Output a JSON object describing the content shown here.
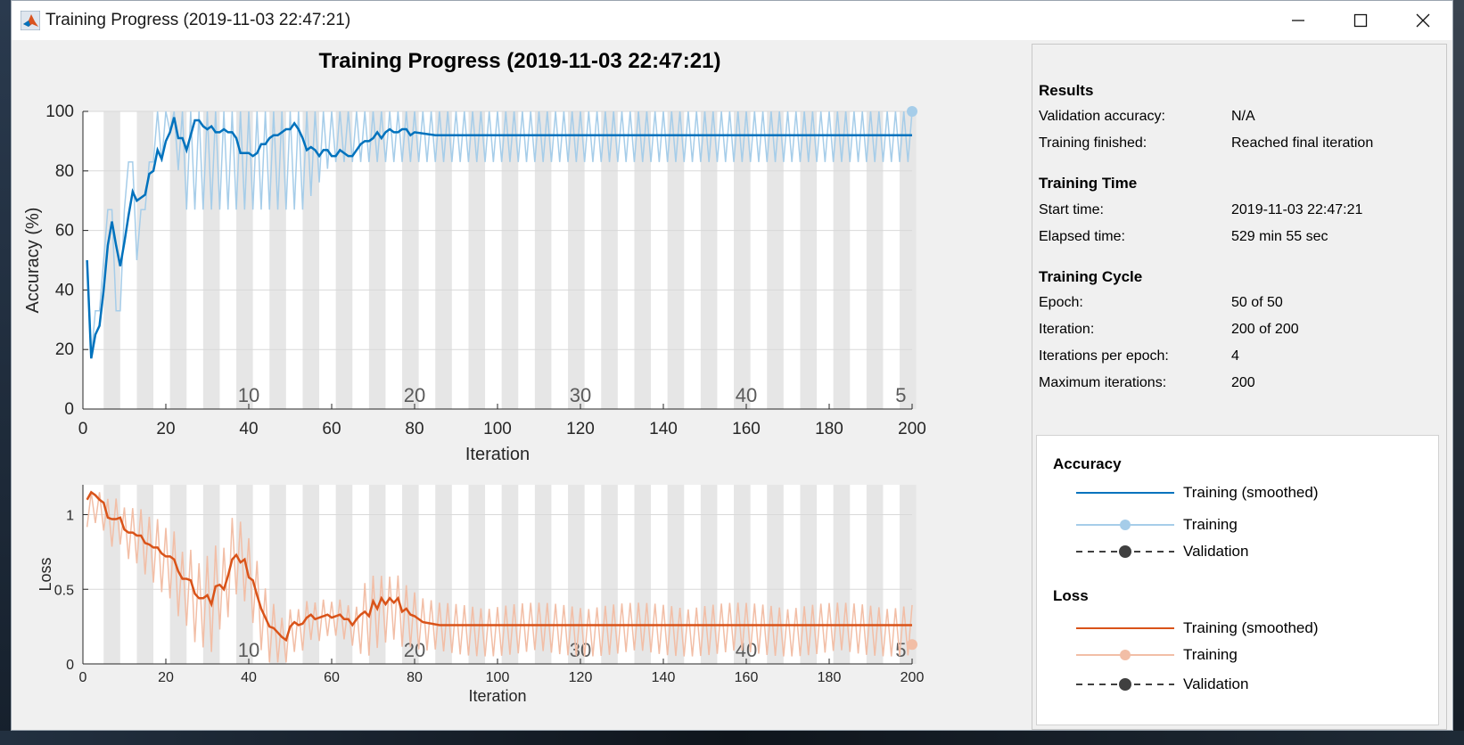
{
  "window": {
    "title": "Training Progress (2019-11-03 22:47:21)"
  },
  "figure_title": "Training Progress (2019-11-03 22:47:21)",
  "results": {
    "heading": "Results",
    "rows": [
      {
        "label": "Validation accuracy:",
        "value": "N/A"
      },
      {
        "label": "Training finished:",
        "value": "Reached final iteration"
      }
    ]
  },
  "training_time": {
    "heading": "Training Time",
    "rows": [
      {
        "label": "Start time:",
        "value": "2019-11-03 22:47:21"
      },
      {
        "label": "Elapsed time:",
        "value": "529 min 55 sec"
      }
    ]
  },
  "training_cycle": {
    "heading": "Training Cycle",
    "rows": [
      {
        "label": "Epoch:",
        "value": "50 of 50"
      },
      {
        "label": "Iteration:",
        "value": "200 of 200"
      },
      {
        "label": "Iterations per epoch:",
        "value": "4"
      },
      {
        "label": "Maximum iterations:",
        "value": "200"
      }
    ]
  },
  "legend": {
    "accuracy": {
      "heading": "Accuracy",
      "items": [
        "Training (smoothed)",
        "Training",
        "Validation"
      ]
    },
    "loss": {
      "heading": "Loss",
      "items": [
        "Training (smoothed)",
        "Training",
        "Validation"
      ]
    }
  },
  "colors": {
    "acc_smoothed": "#0072bd",
    "acc_raw": "#a6cde9",
    "loss_smoothed": "#d95319",
    "loss_raw": "#f2bea6",
    "validation": "#404040",
    "epoch_band": "#e6e6e6",
    "grid": "#d9d9d9"
  },
  "chart_data": [
    {
      "type": "line",
      "ylabel": "Accuracy (%)",
      "xlabel": "Iteration",
      "xlim": [
        0,
        200
      ],
      "ylim": [
        0,
        100
      ],
      "x_ticks": [
        0,
        20,
        40,
        60,
        80,
        100,
        120,
        140,
        160,
        180,
        200
      ],
      "y_ticks": [
        0,
        20,
        40,
        60,
        80,
        100
      ],
      "epoch_labels": [
        10,
        20,
        30,
        40,
        5
      ],
      "epoch_label_x": [
        40,
        80,
        120,
        160,
        199
      ],
      "iterations_per_epoch": 4,
      "series": [
        {
          "name": "Training (smoothed)",
          "points": [
            [
              1,
              50
            ],
            [
              2,
              17
            ],
            [
              3,
              25
            ],
            [
              4,
              28
            ],
            [
              5,
              40
            ],
            [
              6,
              55
            ],
            [
              7,
              63
            ],
            [
              8,
              55
            ],
            [
              9,
              48
            ],
            [
              10,
              56
            ],
            [
              11,
              65
            ],
            [
              12,
              73
            ],
            [
              13,
              70
            ],
            [
              14,
              71
            ],
            [
              15,
              72
            ],
            [
              16,
              79
            ],
            [
              17,
              80
            ],
            [
              18,
              87
            ],
            [
              19,
              84
            ],
            [
              20,
              90
            ],
            [
              21,
              93
            ],
            [
              22,
              98
            ],
            [
              23,
              91
            ],
            [
              24,
              91
            ],
            [
              25,
              87
            ],
            [
              26,
              92
            ],
            [
              27,
              97
            ],
            [
              28,
              97
            ],
            [
              29,
              95
            ],
            [
              30,
              94
            ],
            [
              31,
              95
            ],
            [
              32,
              93
            ],
            [
              33,
              93
            ],
            [
              34,
              94
            ],
            [
              35,
              93
            ],
            [
              36,
              93
            ],
            [
              37,
              91
            ],
            [
              38,
              86
            ],
            [
              39,
              86
            ],
            [
              40,
              86
            ],
            [
              41,
              85
            ],
            [
              42,
              86
            ],
            [
              43,
              89
            ],
            [
              44,
              89
            ],
            [
              45,
              91
            ],
            [
              46,
              92
            ],
            [
              47,
              92
            ],
            [
              48,
              93
            ],
            [
              49,
              94
            ],
            [
              50,
              94
            ],
            [
              51,
              96
            ],
            [
              52,
              94
            ],
            [
              53,
              91
            ],
            [
              54,
              87
            ],
            [
              55,
              88
            ],
            [
              56,
              87
            ],
            [
              57,
              85
            ],
            [
              58,
              87
            ],
            [
              59,
              87
            ],
            [
              60,
              85
            ],
            [
              61,
              85
            ],
            [
              62,
              87
            ],
            [
              63,
              86
            ],
            [
              64,
              85
            ],
            [
              65,
              85
            ],
            [
              66,
              87
            ],
            [
              67,
              89
            ],
            [
              68,
              90
            ],
            [
              69,
              90
            ],
            [
              70,
              91
            ],
            [
              71,
              93
            ],
            [
              72,
              91
            ],
            [
              73,
              93
            ],
            [
              74,
              94
            ],
            [
              75,
              93
            ],
            [
              76,
              93
            ],
            [
              77,
              94
            ],
            [
              78,
              94
            ],
            [
              79,
              92
            ],
            [
              80,
              93
            ],
            [
              85,
              92
            ],
            [
              90,
              92
            ],
            [
              100,
              92
            ],
            [
              120,
              92
            ],
            [
              140,
              92
            ],
            [
              160,
              92
            ],
            [
              180,
              92
            ],
            [
              200,
              92
            ]
          ]
        },
        {
          "name": "Training",
          "low": [
            [
              1,
              50
            ],
            [
              2,
              17
            ],
            [
              3,
              33
            ],
            [
              4,
              33
            ],
            [
              5,
              50
            ],
            [
              6,
              67
            ],
            [
              7,
              67
            ],
            [
              8,
              33
            ],
            [
              9,
              33
            ],
            [
              10,
              67
            ],
            [
              11,
              83
            ],
            [
              12,
              83
            ],
            [
              13,
              50
            ],
            [
              14,
              67
            ],
            [
              15,
              67
            ],
            [
              16,
              83
            ],
            [
              17,
              83
            ],
            [
              18,
              100
            ],
            [
              19,
              83
            ],
            [
              20,
              100
            ],
            [
              25,
              67
            ],
            [
              37,
              67
            ],
            [
              53,
              67
            ],
            [
              60,
              83
            ],
            [
              200,
              83
            ]
          ],
          "high": 100,
          "settle_iter": 18
        },
        {
          "name": "Validation",
          "final_marker": [
            200,
            100
          ]
        }
      ]
    },
    {
      "type": "line",
      "ylabel": "Loss",
      "xlabel": "Iteration",
      "xlim": [
        0,
        200
      ],
      "ylim": [
        0,
        1.2
      ],
      "x_ticks": [
        0,
        20,
        40,
        60,
        80,
        100,
        120,
        140,
        160,
        180,
        200
      ],
      "y_ticks": [
        0,
        0.5,
        1
      ],
      "epoch_labels": [
        10,
        20,
        30,
        40,
        5
      ],
      "epoch_label_x": [
        40,
        80,
        120,
        160,
        199
      ],
      "iterations_per_epoch": 4,
      "series": [
        {
          "name": "Training (smoothed)",
          "points": [
            [
              1,
              1.1
            ],
            [
              2,
              1.15
            ],
            [
              3,
              1.13
            ],
            [
              4,
              1.1
            ],
            [
              5,
              1.08
            ],
            [
              6,
              0.98
            ],
            [
              7,
              0.97
            ],
            [
              8,
              0.97
            ],
            [
              9,
              0.98
            ],
            [
              10,
              0.9
            ],
            [
              11,
              0.88
            ],
            [
              12,
              0.88
            ],
            [
              13,
              0.86
            ],
            [
              14,
              0.86
            ],
            [
              15,
              0.81
            ],
            [
              16,
              0.8
            ],
            [
              17,
              0.78
            ],
            [
              18,
              0.78
            ],
            [
              19,
              0.74
            ],
            [
              20,
              0.72
            ],
            [
              21,
              0.72
            ],
            [
              22,
              0.7
            ],
            [
              23,
              0.62
            ],
            [
              24,
              0.57
            ],
            [
              25,
              0.57
            ],
            [
              26,
              0.56
            ],
            [
              27,
              0.47
            ],
            [
              28,
              0.44
            ],
            [
              29,
              0.44
            ],
            [
              30,
              0.46
            ],
            [
              31,
              0.4
            ],
            [
              32,
              0.52
            ],
            [
              33,
              0.53
            ],
            [
              34,
              0.5
            ],
            [
              35,
              0.59
            ],
            [
              36,
              0.7
            ],
            [
              37,
              0.73
            ],
            [
              38,
              0.68
            ],
            [
              39,
              0.7
            ],
            [
              40,
              0.58
            ],
            [
              41,
              0.56
            ],
            [
              42,
              0.46
            ],
            [
              43,
              0.37
            ],
            [
              44,
              0.31
            ],
            [
              45,
              0.25
            ],
            [
              46,
              0.24
            ],
            [
              47,
              0.21
            ],
            [
              48,
              0.18
            ],
            [
              49,
              0.16
            ],
            [
              50,
              0.25
            ],
            [
              51,
              0.28
            ],
            [
              52,
              0.26
            ],
            [
              53,
              0.27
            ],
            [
              54,
              0.31
            ],
            [
              55,
              0.33
            ],
            [
              56,
              0.3
            ],
            [
              57,
              0.31
            ],
            [
              58,
              0.32
            ],
            [
              59,
              0.33
            ],
            [
              60,
              0.31
            ],
            [
              61,
              0.32
            ],
            [
              62,
              0.33
            ],
            [
              63,
              0.3
            ],
            [
              64,
              0.3
            ],
            [
              65,
              0.26
            ],
            [
              66,
              0.3
            ],
            [
              67,
              0.33
            ],
            [
              68,
              0.35
            ],
            [
              69,
              0.32
            ],
            [
              70,
              0.42
            ],
            [
              71,
              0.37
            ],
            [
              72,
              0.44
            ],
            [
              73,
              0.4
            ],
            [
              74,
              0.44
            ],
            [
              75,
              0.41
            ],
            [
              76,
              0.44
            ],
            [
              77,
              0.35
            ],
            [
              78,
              0.37
            ],
            [
              79,
              0.33
            ],
            [
              80,
              0.32
            ],
            [
              82,
              0.28
            ],
            [
              84,
              0.27
            ],
            [
              86,
              0.26
            ],
            [
              200,
              0.26
            ]
          ]
        },
        {
          "name": "Training",
          "swing": [
            [
              0,
              0.15
            ],
            [
              10,
              0.18
            ],
            [
              20,
              0.25
            ],
            [
              30,
              0.32
            ],
            [
              40,
              0.3
            ],
            [
              52,
              0.16
            ],
            [
              66,
              0.12
            ],
            [
              67,
              0.25
            ],
            [
              80,
              0.2
            ],
            [
              86,
              0.18
            ],
            [
              200,
              0.18
            ]
          ],
          "center_offset": -0.03
        },
        {
          "name": "Validation",
          "final_marker": [
            200,
            0.13
          ]
        }
      ]
    }
  ]
}
